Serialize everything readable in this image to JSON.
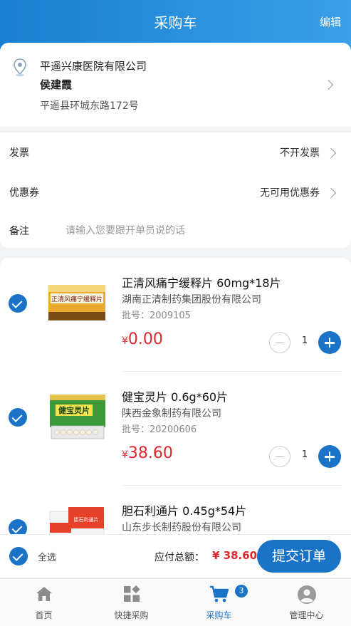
{
  "header": {
    "title": "采购车",
    "edit_label": "编辑"
  },
  "address": {
    "company": "平遥兴康医院有限公司",
    "contact": "侯建霞",
    "street": "平遥县环城东路172号"
  },
  "options": {
    "invoice_label": "发票",
    "invoice_value": "不开发票",
    "coupon_label": "优惠券",
    "coupon_value": "无可用优惠券",
    "remark_label": "备注",
    "remark_placeholder": "请输入您要跟开单员说的话"
  },
  "products": [
    {
      "name": "正清风痛宁缓释片 60mg*18片",
      "manufacturer": "湖南正清制药集团股份有限公司",
      "batch": "批号：2009105",
      "currency": "¥",
      "price": "0.00",
      "qty": "1",
      "box_text": "正清风痛宁缓释片"
    },
    {
      "name": "健宝灵片 0.6g*60片",
      "manufacturer": "陕西金象制药有限公司",
      "batch": "批号：20200606",
      "currency": "¥",
      "price": "38.60",
      "qty": "1",
      "box_text": "健宝灵片"
    },
    {
      "name": "胆石利通片 0.45g*54片",
      "manufacturer": "山东步长制药股份有限公司",
      "box_text": "胆石利通片"
    }
  ],
  "footer": {
    "select_all": "全选",
    "total_label": "应付总额：",
    "total_value": "¥ 38.60",
    "submit_label": "提交订单"
  },
  "tabs": [
    {
      "label": "首页",
      "icon": "home-icon"
    },
    {
      "label": "快捷采购",
      "icon": "grid-icon"
    },
    {
      "label": "采购车",
      "icon": "cart-icon",
      "badge": "3"
    },
    {
      "label": "管理中心",
      "icon": "user-icon"
    }
  ],
  "colors": {
    "primary": "#1a73c6",
    "price": "#e0262b",
    "header_gradient_start": "#1a7fd0",
    "header_gradient_end": "#3aa0ea"
  }
}
